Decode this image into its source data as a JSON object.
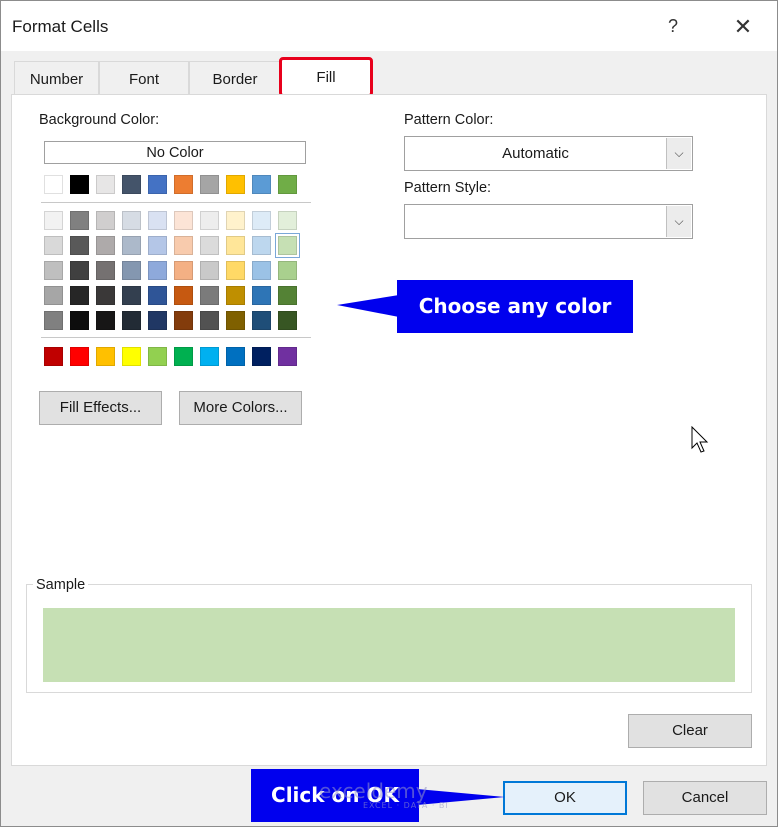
{
  "window": {
    "title": "Format Cells",
    "help_glyph": "?",
    "close_glyph": "✕"
  },
  "tabs": [
    {
      "label": "Number",
      "active": false
    },
    {
      "label": "Font",
      "active": false
    },
    {
      "label": "Border",
      "active": false
    },
    {
      "label": "Fill",
      "active": true
    }
  ],
  "background_color": {
    "label": "Background Color:",
    "no_color_label": "No Color",
    "theme_top_row": [
      "#ffffff",
      "#000000",
      "#e7e6e6",
      "#44546a",
      "#4472c4",
      "#ed7d31",
      "#a5a5a5",
      "#ffc000",
      "#5b9bd5",
      "#70ad47"
    ],
    "theme_tints": [
      [
        "#f2f2f2",
        "#808080",
        "#d0cece",
        "#d6dce4",
        "#d9e1f2",
        "#fce4d6",
        "#ededed",
        "#fff2cc",
        "#ddebf7",
        "#e2efda"
      ],
      [
        "#d9d9d9",
        "#595959",
        "#aeaaaa",
        "#acb9ca",
        "#b4c6e7",
        "#f8cbad",
        "#dbdbdb",
        "#ffe699",
        "#bdd7ee",
        "#c6e0b4"
      ],
      [
        "#bfbfbf",
        "#404040",
        "#757171",
        "#8497b0",
        "#8ea9db",
        "#f4b084",
        "#c9c9c9",
        "#ffd966",
        "#9bc2e6",
        "#a9d08e"
      ],
      [
        "#a6a6a6",
        "#262626",
        "#3a3838",
        "#333f4f",
        "#2f5597",
        "#c65911",
        "#7b7b7b",
        "#bf8f00",
        "#2e75b6",
        "#548235"
      ],
      [
        "#808080",
        "#0d0d0d",
        "#171616",
        "#222b35",
        "#203764",
        "#833c0c",
        "#525252",
        "#7f6000",
        "#1f4e78",
        "#375623"
      ]
    ],
    "standard_colors": [
      "#c00000",
      "#ff0000",
      "#ffc000",
      "#ffff00",
      "#92d050",
      "#00b050",
      "#00b0f0",
      "#0070c0",
      "#002060",
      "#7030a0"
    ],
    "selected_color": "#c6e0b4"
  },
  "buttons": {
    "fill_effects": "Fill Effects...",
    "more_colors": "More Colors...",
    "clear": "Clear",
    "ok": "OK",
    "cancel": "Cancel"
  },
  "pattern": {
    "color_label": "Pattern Color:",
    "color_value": "Automatic",
    "style_label": "Pattern Style:",
    "style_value": "",
    "arrow_glyph": "⌵"
  },
  "sample": {
    "label": "Sample",
    "color": "#c6e0b4"
  },
  "annotations": {
    "choose_color": "Choose any color",
    "click_ok": "Click on OK",
    "callout_color": "#0000ee"
  },
  "watermark": {
    "brand": "exceldemy",
    "tagline": "EXCEL · DATA · BI"
  }
}
